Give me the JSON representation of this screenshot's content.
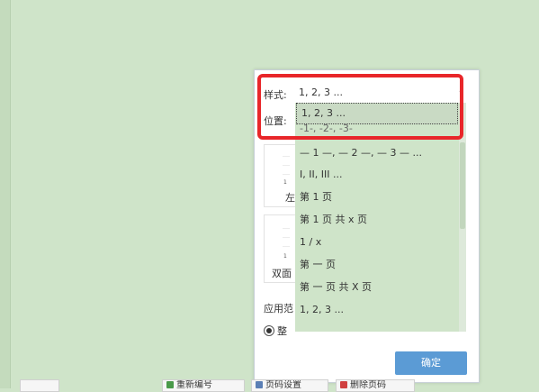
{
  "dialog": {
    "style_label": "样式:",
    "style_value": "1, 2, 3 ...",
    "position_label": "位置:",
    "thumb_left_caption": "左",
    "thumb_left_num": "1",
    "thumb_double_caption": "双面",
    "thumb_double_num": "1",
    "apply_range_label": "应用范",
    "radio_label": "整",
    "ok_label": "确定"
  },
  "dropdown": {
    "items": [
      "1, 2, 3 ...",
      "-1-, -2-, -3-",
      "— 1 —, — 2 —, — 3 — ...",
      "I, II, III ...",
      "第 1 页",
      "第 1 页 共 x 页",
      "1 / x",
      "第 一 页",
      "第 一 页 共 X 页",
      "1, 2, 3 ..."
    ],
    "selected_index": 0
  },
  "taskbar": {
    "tabs": [
      "重新编号",
      "页码设置",
      "删除页码"
    ]
  },
  "colors": {
    "background": "#cfe4c9",
    "accent": "#5b9bd5",
    "highlight": "#e8262a"
  }
}
